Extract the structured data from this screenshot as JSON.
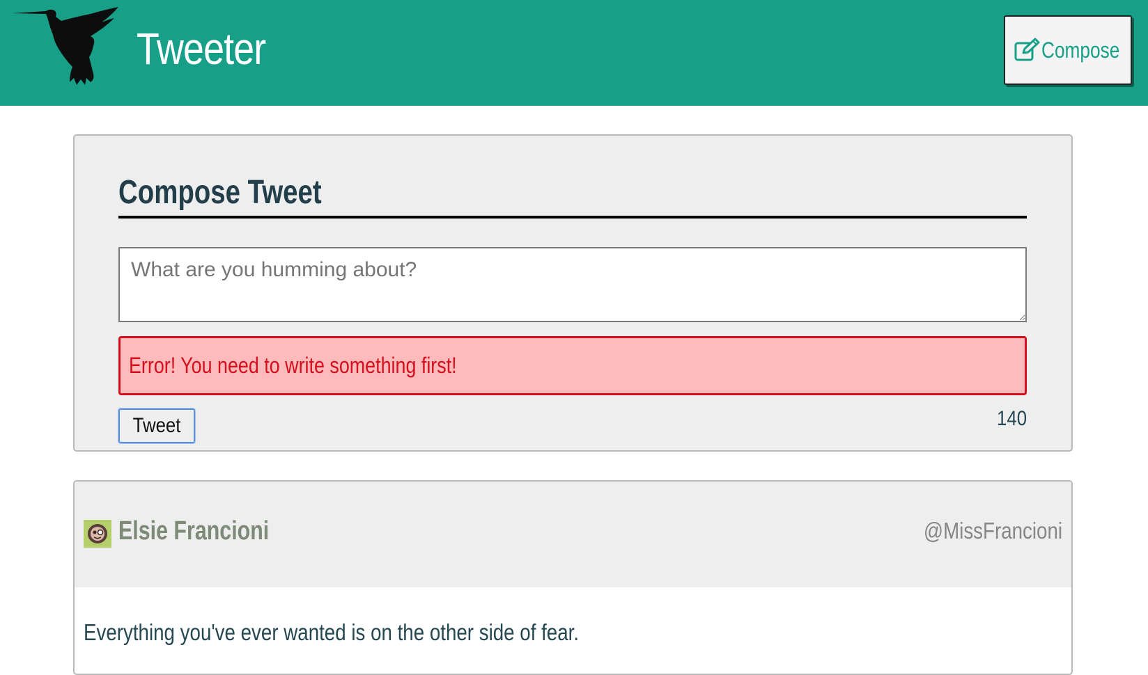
{
  "nav": {
    "brand": "Tweeter",
    "compose_label": "Compose",
    "logo_icon": "hummingbird-icon",
    "compose_icon": "edit-icon",
    "background_color": "#17a087"
  },
  "compose": {
    "title": "Compose Tweet",
    "placeholder": "What are you humming about?",
    "error_message": "Error! You need to write something first!",
    "tweet_button_label": "Tweet",
    "char_counter": "140",
    "error_color": "#d40f1e"
  },
  "tweets": [
    {
      "name": "Elsie Francioni",
      "handle": "@MissFrancioni",
      "text": "Everything you've ever wanted is on the other side of fear.",
      "avatar_icon": "avatar-icon"
    }
  ]
}
